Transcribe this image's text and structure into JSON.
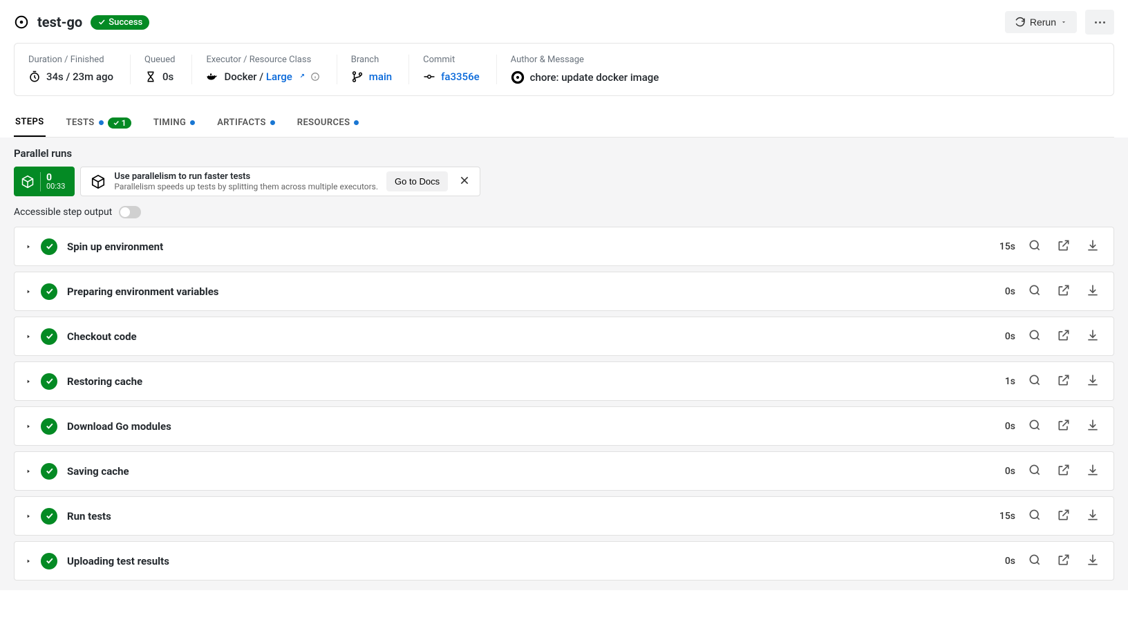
{
  "header": {
    "job_name": "test-go",
    "status_label": "Success",
    "rerun_label": "Rerun"
  },
  "meta": {
    "duration_label": "Duration / Finished",
    "duration_value": "34s / 23m ago",
    "queued_label": "Queued",
    "queued_value": "0s",
    "executor_label": "Executor / Resource Class",
    "executor_name": "Docker / ",
    "executor_class": "Large",
    "branch_label": "Branch",
    "branch_value": "main",
    "commit_label": "Commit",
    "commit_value": "fa3356e",
    "author_label": "Author & Message",
    "commit_message": "chore: update docker image"
  },
  "tabs": {
    "steps": "STEPS",
    "tests": "TESTS",
    "tests_badge": "1",
    "timing": "TIMING",
    "artifacts": "ARTIFACTS",
    "resources": "RESOURCES"
  },
  "parallel": {
    "title": "Parallel runs",
    "index": "0",
    "time": "00:33",
    "info_title": "Use parallelism to run faster tests",
    "info_sub": "Parallelism speeds up tests by splitting them across multiple executors.",
    "docs_btn": "Go to Docs"
  },
  "accessible_label": "Accessible step output",
  "steps": [
    {
      "name": "Spin up environment",
      "duration": "15s"
    },
    {
      "name": "Preparing environment variables",
      "duration": "0s"
    },
    {
      "name": "Checkout code",
      "duration": "0s"
    },
    {
      "name": "Restoring cache",
      "duration": "1s"
    },
    {
      "name": "Download Go modules",
      "duration": "0s"
    },
    {
      "name": "Saving cache",
      "duration": "0s"
    },
    {
      "name": "Run tests",
      "duration": "15s"
    },
    {
      "name": "Uploading test results",
      "duration": "0s"
    }
  ]
}
